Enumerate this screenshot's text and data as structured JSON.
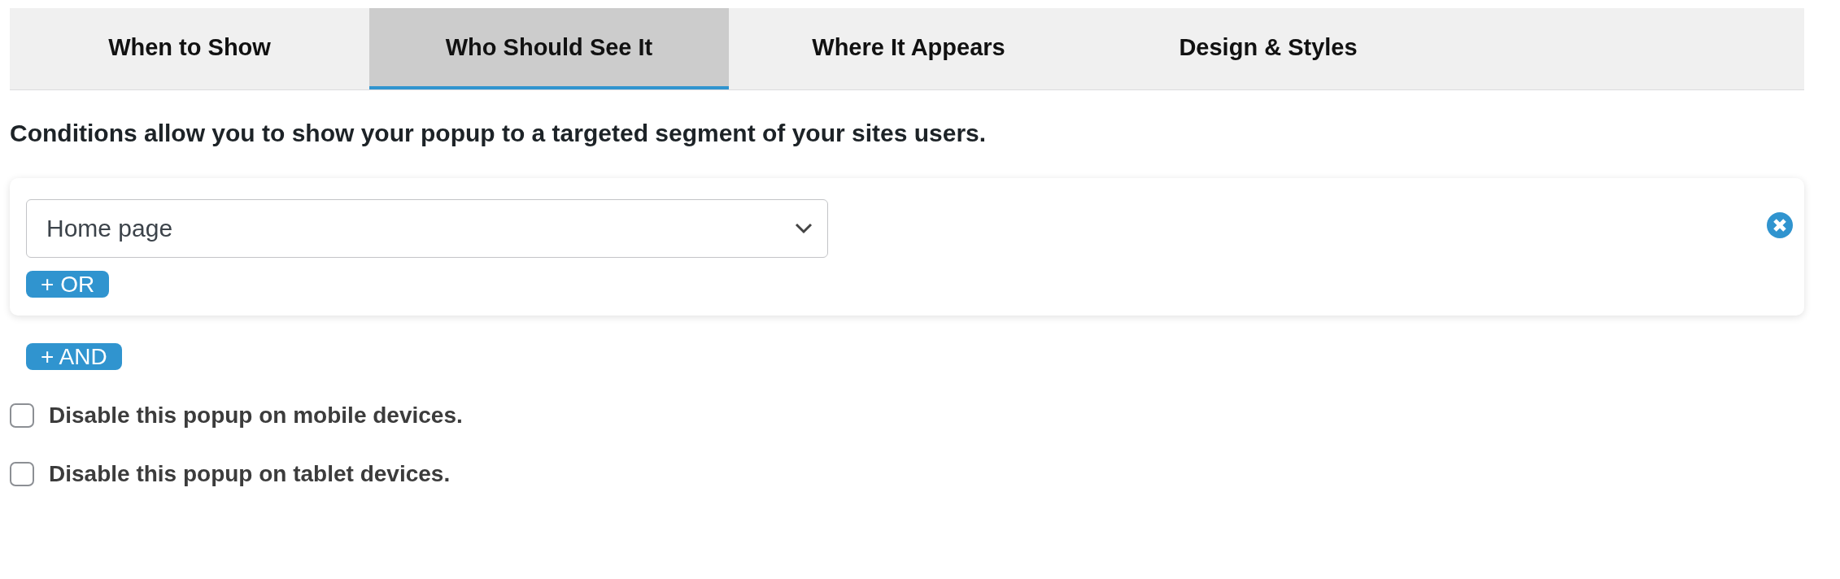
{
  "tabs": [
    {
      "label": "When to Show",
      "selected": false
    },
    {
      "label": "Who Should See It",
      "selected": true
    },
    {
      "label": "Where It Appears",
      "selected": false
    },
    {
      "label": "Design & Styles",
      "selected": false
    }
  ],
  "intro": "Conditions allow you to show your popup to a targeted segment of your sites users.",
  "condition_group": {
    "select_value": "Home page",
    "or_button": "+ OR"
  },
  "and_button": "+ AND",
  "options": [
    {
      "label": "Disable this popup on mobile devices.",
      "checked": false
    },
    {
      "label": "Disable this popup on tablet devices.",
      "checked": false
    }
  ]
}
